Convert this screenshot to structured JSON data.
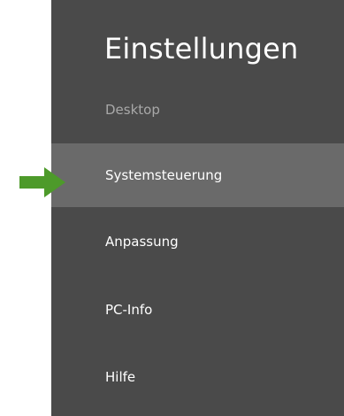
{
  "panel": {
    "title": "Einstellungen",
    "context": "Desktop",
    "items": [
      {
        "label": "Systemsteuerung",
        "highlighted": true
      },
      {
        "label": "Anpassung",
        "highlighted": false
      },
      {
        "label": "PC-Info",
        "highlighted": false
      },
      {
        "label": "Hilfe",
        "highlighted": false
      }
    ]
  },
  "annotation": {
    "icon": "arrow-right-icon",
    "color": "#4d9a2a"
  },
  "colors": {
    "panel_background": "#4a4a4a",
    "highlight_background": "#6a6a6a",
    "text": "#ffffff",
    "muted_text": "#a8a8a8"
  }
}
